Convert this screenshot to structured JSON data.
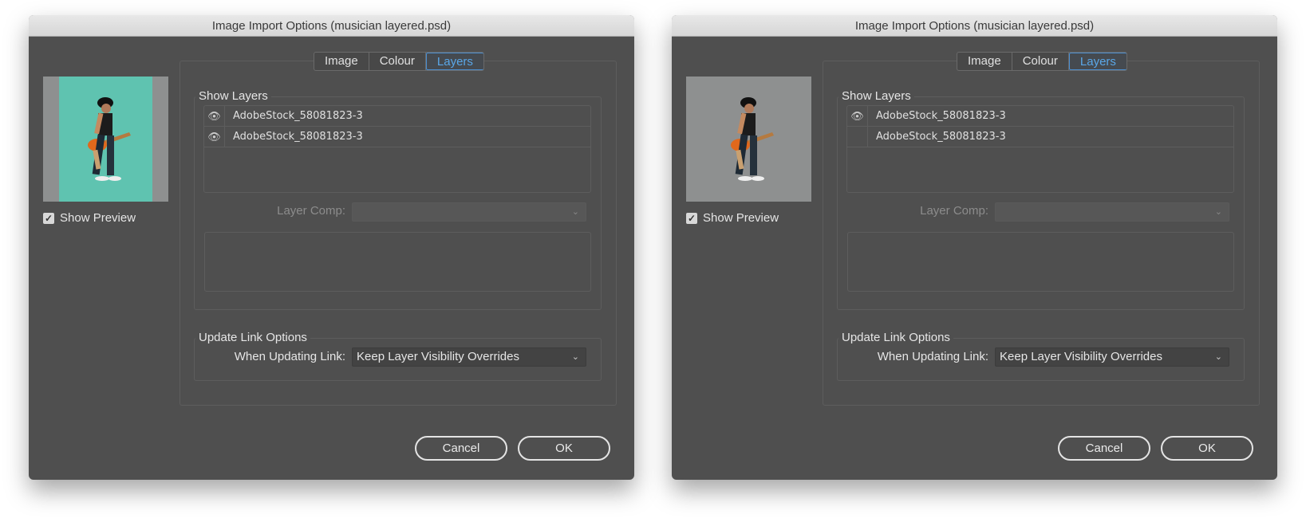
{
  "dialogs": [
    {
      "title": "Image Import Options (musician layered.psd)",
      "tabs": [
        "Image",
        "Colour",
        "Layers"
      ],
      "selected_tab": "Layers",
      "preview_background": "teal",
      "show_preview_label": "Show Preview",
      "show_preview_checked": true,
      "show_layers_label": "Show Layers",
      "layers": [
        {
          "name": "AdobeStock_58081823-3",
          "visible": true
        },
        {
          "name": "AdobeStock_58081823-3",
          "visible": true
        }
      ],
      "layer_comp_label": "Layer Comp:",
      "layer_comp_value": "",
      "update_link_label": "Update Link Options",
      "when_updating_label": "When Updating Link:",
      "when_updating_value": "Keep Layer Visibility Overrides",
      "cancel": "Cancel",
      "ok": "OK"
    },
    {
      "title": "Image Import Options (musician layered.psd)",
      "tabs": [
        "Image",
        "Colour",
        "Layers"
      ],
      "selected_tab": "Layers",
      "preview_background": "gray",
      "show_preview_label": "Show Preview",
      "show_preview_checked": true,
      "show_layers_label": "Show Layers",
      "layers": [
        {
          "name": "AdobeStock_58081823-3",
          "visible": true
        },
        {
          "name": "AdobeStock_58081823-3",
          "visible": false
        }
      ],
      "layer_comp_label": "Layer Comp:",
      "layer_comp_value": "",
      "update_link_label": "Update Link Options",
      "when_updating_label": "When Updating Link:",
      "when_updating_value": "Keep Layer Visibility Overrides",
      "cancel": "Cancel",
      "ok": "OK"
    }
  ],
  "colors": {
    "accent": "#5aa7e8",
    "dialog_bg": "#4f4f4f"
  }
}
